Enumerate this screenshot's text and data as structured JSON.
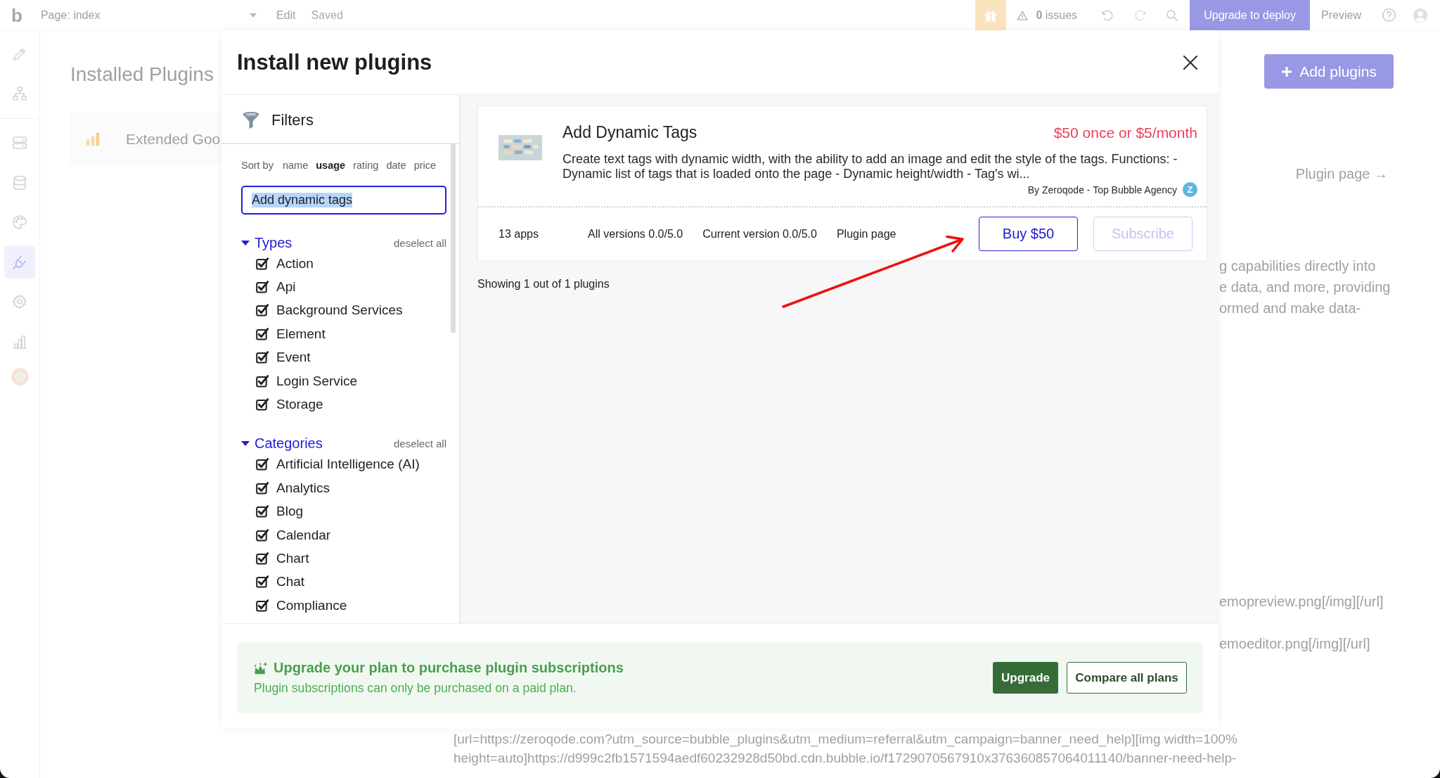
{
  "top_bar": {
    "logo": "b",
    "page_selector": "Page: index",
    "menu": "Edit",
    "save_status": "Saved",
    "issues": "**0** issues",
    "deploy_button": "Upgrade to deploy",
    "preview_button": "Preview"
  },
  "sidebar": {
    "items": [
      {
        "kind": "design",
        "selected": false
      },
      {
        "kind": "workflow",
        "selected": false
      },
      {
        "kind": "backend",
        "selected": false
      },
      {
        "kind": "data",
        "selected": false
      },
      {
        "kind": "styles",
        "selected": false
      },
      {
        "kind": "plugins",
        "selected": true
      },
      {
        "kind": "settings",
        "selected": false
      },
      {
        "kind": "logs",
        "selected": false
      }
    ]
  },
  "background": {
    "heading": "Installed Plugins",
    "add_button": "Add plugins",
    "plugin_card": {
      "name": "Extended Goo"
    },
    "plugin_link": "Plugin page →",
    "description_lines": [
      "g capabilities directly into",
      "e data, and more, providing",
      "ormed and make data-"
    ],
    "markup_lines": [
      "emopreview.png[/img][/url]",
      "emoeditor.png[/img][/url]"
    ],
    "code_lines": [
      "[url=https://zeroqode.com?utm_source=bubble_plugins&utm_medium=referral&utm_campaign=banner_need_help][img width=100%",
      "height=auto]https://d999c2fb1571594aedf60232928d50bd.cdn.bubble.io/f1729070567910x376360857064011140/banner-need-help-"
    ]
  },
  "modal": {
    "title": "Install new plugins",
    "filters": {
      "title": "Filters",
      "sort_label": "Sort by",
      "sort_options": [
        {
          "label": "name",
          "selected": false
        },
        {
          "label": "usage",
          "selected": true
        },
        {
          "label": "rating",
          "selected": false
        },
        {
          "label": "date",
          "selected": false
        },
        {
          "label": "price",
          "selected": false
        }
      ],
      "search": {
        "value": "Add dynamic tags",
        "highlighted": true
      },
      "groups": [
        {
          "title": "Types",
          "expanded": true,
          "action": "deselect all",
          "items": [
            {
              "label": "Action",
              "checked": true
            },
            {
              "label": "Api",
              "checked": true
            },
            {
              "label": "Background Services",
              "checked": true
            },
            {
              "label": "Element",
              "checked": true
            },
            {
              "label": "Event",
              "checked": true
            },
            {
              "label": "Login Service",
              "checked": true
            },
            {
              "label": "Storage",
              "checked": true
            }
          ]
        },
        {
          "title": "Categories",
          "expanded": true,
          "action": "deselect all",
          "items": [
            {
              "label": "Artificial Intelligence (AI)",
              "checked": true
            },
            {
              "label": "Analytics",
              "checked": true
            },
            {
              "label": "Blog",
              "checked": true
            },
            {
              "label": "Calendar",
              "checked": true
            },
            {
              "label": "Chart",
              "checked": true
            },
            {
              "label": "Chat",
              "checked": true
            },
            {
              "label": "Compliance",
              "checked": true
            }
          ]
        }
      ]
    },
    "results": {
      "plugins": [
        {
          "name": "Add Dynamic Tags",
          "price": "$50 once or $5/month",
          "description": "Create text tags with dynamic width, with the ability to add an image and edit the style of the tags. Functions: - Dynamic list of tags that is loaded onto the page - Dynamic height/width - Tag's wi...",
          "author": "By Zeroqode - Top Bubble Agency",
          "author_badge": "Z",
          "apps": "13 apps",
          "all_versions": "All versions 0.0/5.0",
          "current_version": "Current version 0.0/5.0",
          "link": "Plugin page",
          "buttons": [
            {
              "label": "Buy $50",
              "disabled": false
            },
            {
              "label": "Subscribe",
              "disabled": true
            }
          ]
        }
      ],
      "summary": "Showing 1 out of 1 plugins"
    },
    "upgrade_banner": {
      "title": "Upgrade your plan to purchase plugin subscriptions",
      "text": "Plugin subscriptions can only be purchased on a paid plan.",
      "buttons": [
        {
          "label": "Upgrade",
          "kind": "primary"
        },
        {
          "label": "Compare all plans",
          "kind": "secondary"
        }
      ]
    }
  }
}
